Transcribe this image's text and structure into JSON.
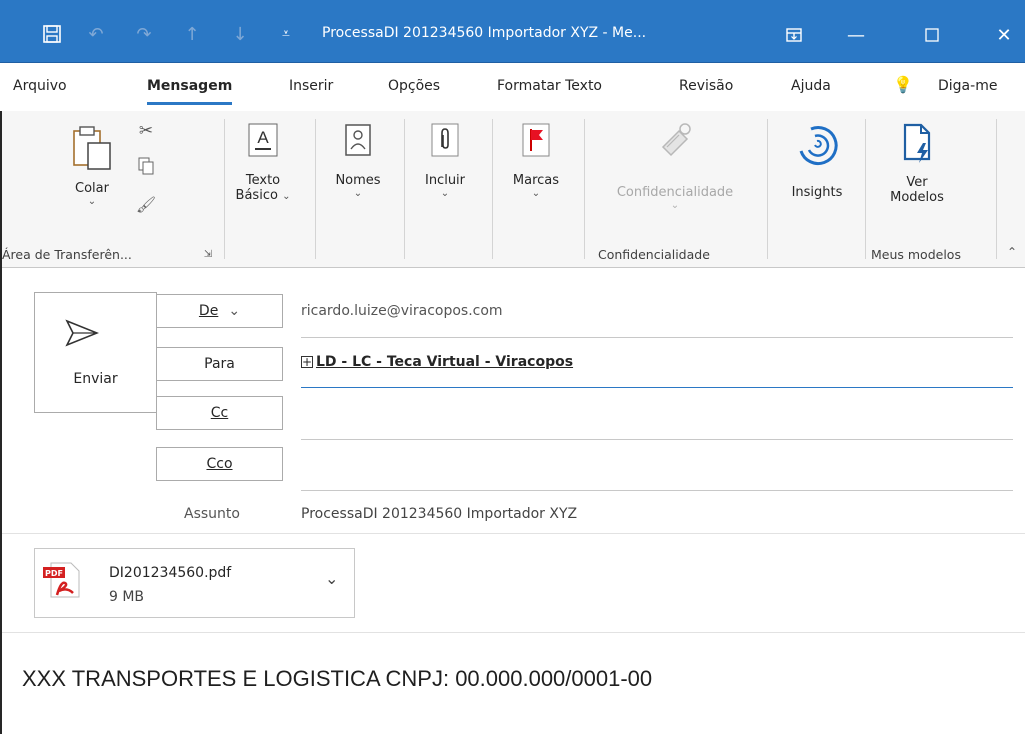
{
  "window": {
    "title": "ProcessaDI 201234560 Importador XYZ  -  Me..."
  },
  "tabs": [
    {
      "label": "Arquivo"
    },
    {
      "label": "Mensagem"
    },
    {
      "label": "Inserir"
    },
    {
      "label": "Opções"
    },
    {
      "label": "Formatar Texto"
    },
    {
      "label": "Revisão"
    },
    {
      "label": "Ajuda"
    },
    {
      "label": "Diga-me"
    }
  ],
  "ribbon": {
    "paste_label": "Colar",
    "basic_text_line1": "Texto",
    "basic_text_line2": "Básico",
    "names_label": "Nomes",
    "include_label": "Incluir",
    "tags_label": "Marcas",
    "confidentiality_label": "Confidencialidade",
    "insights_label": "Insights",
    "view_templates_line1": "Ver",
    "view_templates_line2": "Modelos",
    "group_clipboard": "Área de Transferên...",
    "group_confidentiality": "Confidencialidade",
    "group_my_templates": "Meus modelos"
  },
  "compose": {
    "send_label": "Enviar",
    "from_label": "De",
    "from_value": "ricardo.luize@viracopos.com",
    "to_label": "Para",
    "to_value": "LD - LC - Teca Virtual - Viracopos",
    "cc_label": "Cc",
    "bcc_label": "Cco",
    "subject_label": "Assunto",
    "subject_value": "ProcessaDI 201234560 Importador XYZ"
  },
  "attachment": {
    "filename": "DI201234560.pdf",
    "size": "9 MB",
    "badge": "PDF"
  },
  "body": {
    "text": "XXX TRANSPORTES E LOGISTICA CNPJ: 00.000.000/0001-00"
  },
  "colors": {
    "titlebar": "#2b78c5",
    "accent": "#2b78c5",
    "ribbon_bg": "#f6f6f6"
  }
}
